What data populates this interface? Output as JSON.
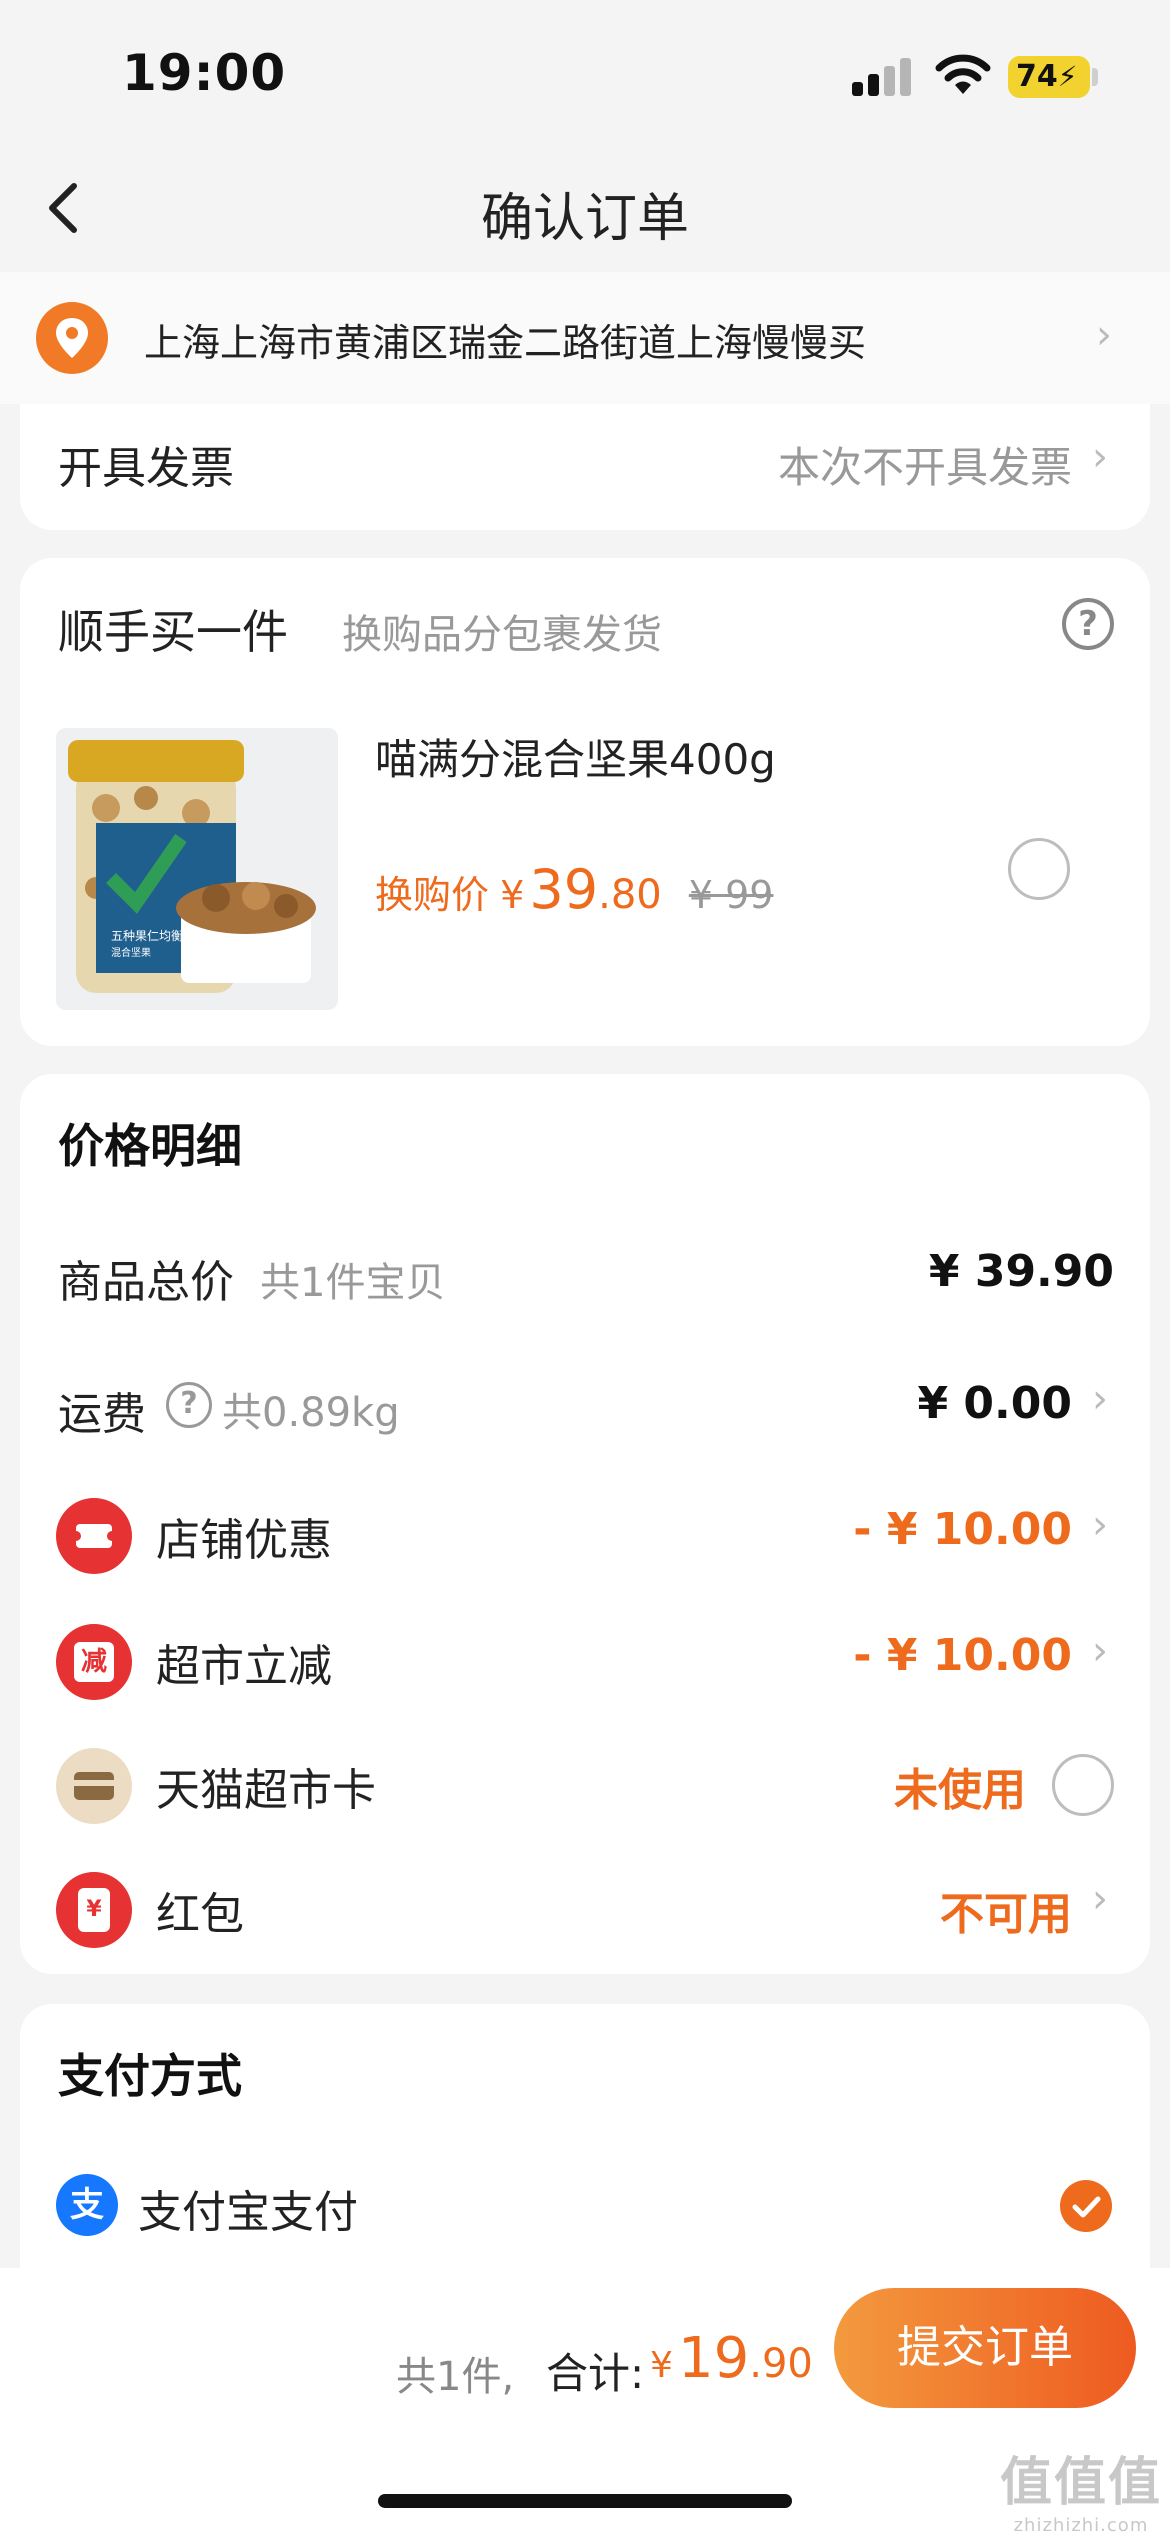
{
  "status_bar": {
    "time": "19:00",
    "battery": "74"
  },
  "nav": {
    "title": "确认订单"
  },
  "address": {
    "text": "上海上海市黄浦区瑞金二路街道上海慢慢买"
  },
  "invoice": {
    "label": "开具发票",
    "value": "本次不开具发票"
  },
  "addon": {
    "title": "顺手买一件",
    "subtitle": "换购品分包裹发货",
    "product": {
      "name": "喵满分混合坚果400g",
      "price_label": "换购价",
      "currency": "¥",
      "price_int": "39",
      "price_dec": ".80",
      "original_price": "¥ 99",
      "jar_label": "五种果仁均衡",
      "jar_sub": "混合坚果"
    }
  },
  "price_detail": {
    "title": "价格明细",
    "goods_total": {
      "label": "商品总价",
      "sub": "共1件宝贝",
      "amount": "¥ 39.90"
    },
    "shipping": {
      "label": "运费",
      "sub": "共0.89kg",
      "amount": "¥ 0.00"
    },
    "store_discount": {
      "label": "店铺优惠",
      "amount": "- ¥ 10.00"
    },
    "market_discount": {
      "label": "超市立减",
      "amount": "- ¥ 10.00",
      "icon_text": "减"
    },
    "card": {
      "label": "天猫超市卡",
      "status": "未使用"
    },
    "red_packet": {
      "label": "红包",
      "status": "不可用",
      "icon_text": "¥"
    }
  },
  "payment": {
    "title": "支付方式",
    "method": "支付宝支付",
    "method_icon_text": "支"
  },
  "footer": {
    "count_text": "共1件,",
    "total_label": "合计:",
    "currency": "¥",
    "total_int": "19",
    "total_dec": ".90",
    "submit_label": "提交订单"
  },
  "watermark": {
    "logo": "值值值",
    "url": "zhizhizhi.com"
  },
  "colors": {
    "accent": "#ee6a1d",
    "icon_red": "#e63232",
    "pin_orange": "#f17a26",
    "alipay_blue": "#1677ff"
  }
}
